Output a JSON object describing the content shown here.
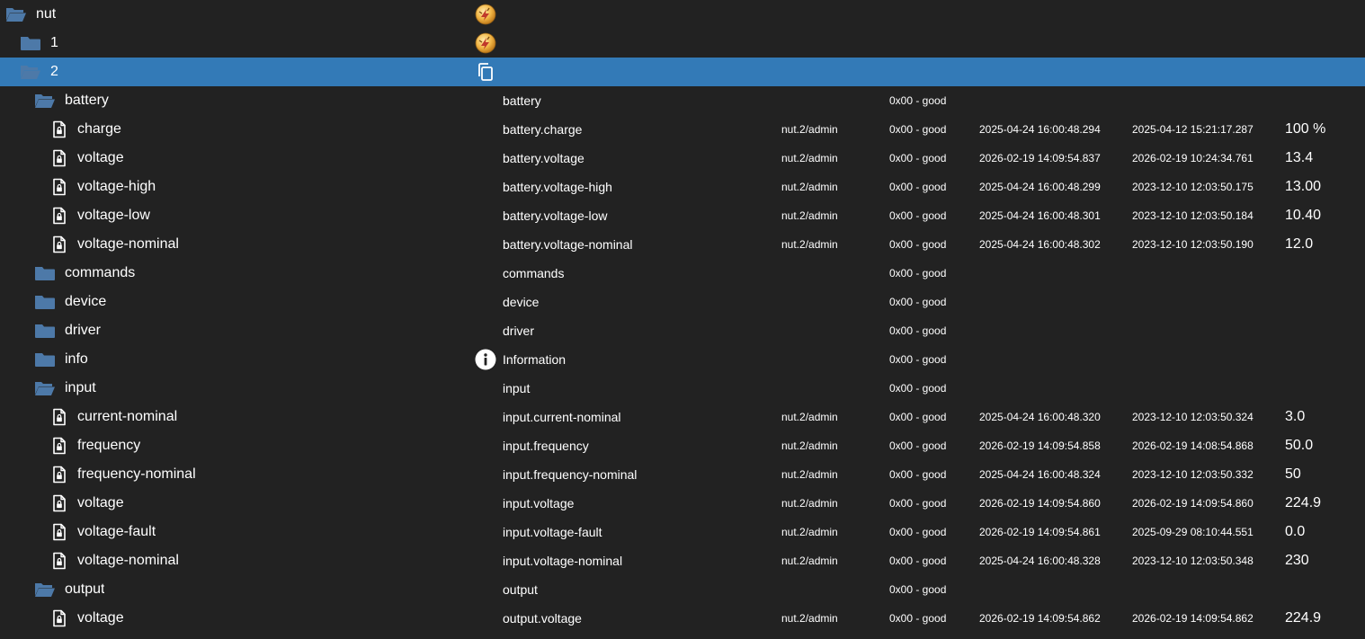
{
  "colors": {
    "background": "#222222",
    "selected_row": "#337ab7",
    "folder": "#4d79a8",
    "text": "#ffffff"
  },
  "rows": [
    {
      "id": "nut",
      "type": "folder-open",
      "name": "nut",
      "desc": "",
      "user": "",
      "quality": "",
      "ts": "",
      "lc": "",
      "value": "",
      "role": "ups"
    },
    {
      "id": "nut-1",
      "type": "folder",
      "name": "1",
      "desc": "",
      "user": "",
      "quality": "",
      "ts": "",
      "lc": "",
      "value": "",
      "role": "ups"
    },
    {
      "id": "nut-2",
      "type": "folder-open",
      "name": "2",
      "desc": "",
      "user": "",
      "quality": "",
      "ts": "",
      "lc": "",
      "value": "",
      "role": "copy",
      "selected": true
    },
    {
      "id": "battery",
      "type": "folder-open",
      "name": "battery",
      "desc": "battery",
      "user": "",
      "quality": "0x00 - good",
      "ts": "",
      "lc": "",
      "value": ""
    },
    {
      "id": "battery-charge",
      "type": "file",
      "name": "charge",
      "desc": "battery.charge",
      "user": "nut.2/admin",
      "quality": "0x00 - good",
      "ts": "2025-04-24 16:00:48.294",
      "lc": "2025-04-12 15:21:17.287",
      "value": "100 %"
    },
    {
      "id": "battery-voltage",
      "type": "file",
      "name": "voltage",
      "desc": "battery.voltage",
      "user": "nut.2/admin",
      "quality": "0x00 - good",
      "ts": "2026-02-19 14:09:54.837",
      "lc": "2026-02-19 10:24:34.761",
      "value": "13.4"
    },
    {
      "id": "battery-voltage-high",
      "type": "file",
      "name": "voltage-high",
      "desc": "battery.voltage-high",
      "user": "nut.2/admin",
      "quality": "0x00 - good",
      "ts": "2025-04-24 16:00:48.299",
      "lc": "2023-12-10 12:03:50.175",
      "value": "13.00"
    },
    {
      "id": "battery-voltage-low",
      "type": "file",
      "name": "voltage-low",
      "desc": "battery.voltage-low",
      "user": "nut.2/admin",
      "quality": "0x00 - good",
      "ts": "2025-04-24 16:00:48.301",
      "lc": "2023-12-10 12:03:50.184",
      "value": "10.40"
    },
    {
      "id": "battery-voltage-nominal",
      "type": "file",
      "name": "voltage-nominal",
      "desc": "battery.voltage-nominal",
      "user": "nut.2/admin",
      "quality": "0x00 - good",
      "ts": "2025-04-24 16:00:48.302",
      "lc": "2023-12-10 12:03:50.190",
      "value": "12.0"
    },
    {
      "id": "commands",
      "type": "folder",
      "name": "commands",
      "desc": "commands",
      "user": "",
      "quality": "0x00 - good",
      "ts": "",
      "lc": "",
      "value": ""
    },
    {
      "id": "device",
      "type": "folder",
      "name": "device",
      "desc": "device",
      "user": "",
      "quality": "0x00 - good",
      "ts": "",
      "lc": "",
      "value": ""
    },
    {
      "id": "driver",
      "type": "folder",
      "name": "driver",
      "desc": "driver",
      "user": "",
      "quality": "0x00 - good",
      "ts": "",
      "lc": "",
      "value": ""
    },
    {
      "id": "info",
      "type": "folder",
      "name": "info",
      "desc": "Information",
      "user": "",
      "quality": "0x00 - good",
      "ts": "",
      "lc": "",
      "value": "",
      "role": "info"
    },
    {
      "id": "input",
      "type": "folder-open",
      "name": "input",
      "desc": "input",
      "user": "",
      "quality": "0x00 - good",
      "ts": "",
      "lc": "",
      "value": ""
    },
    {
      "id": "input-current-nominal",
      "type": "file",
      "name": "current-nominal",
      "desc": "input.current-nominal",
      "user": "nut.2/admin",
      "quality": "0x00 - good",
      "ts": "2025-04-24 16:00:48.320",
      "lc": "2023-12-10 12:03:50.324",
      "value": "3.0"
    },
    {
      "id": "input-frequency",
      "type": "file",
      "name": "frequency",
      "desc": "input.frequency",
      "user": "nut.2/admin",
      "quality": "0x00 - good",
      "ts": "2026-02-19 14:09:54.858",
      "lc": "2026-02-19 14:08:54.868",
      "value": "50.0"
    },
    {
      "id": "input-frequency-nominal",
      "type": "file",
      "name": "frequency-nominal",
      "desc": "input.frequency-nominal",
      "user": "nut.2/admin",
      "quality": "0x00 - good",
      "ts": "2025-04-24 16:00:48.324",
      "lc": "2023-12-10 12:03:50.332",
      "value": "50"
    },
    {
      "id": "input-voltage",
      "type": "file",
      "name": "voltage",
      "desc": "input.voltage",
      "user": "nut.2/admin",
      "quality": "0x00 - good",
      "ts": "2026-02-19 14:09:54.860",
      "lc": "2026-02-19 14:09:54.860",
      "value": "224.9"
    },
    {
      "id": "input-voltage-fault",
      "type": "file",
      "name": "voltage-fault",
      "desc": "input.voltage-fault",
      "user": "nut.2/admin",
      "quality": "0x00 - good",
      "ts": "2026-02-19 14:09:54.861",
      "lc": "2025-09-29 08:10:44.551",
      "value": "0.0"
    },
    {
      "id": "input-voltage-nominal",
      "type": "file",
      "name": "voltage-nominal",
      "desc": "input.voltage-nominal",
      "user": "nut.2/admin",
      "quality": "0x00 - good",
      "ts": "2025-04-24 16:00:48.328",
      "lc": "2023-12-10 12:03:50.348",
      "value": "230"
    },
    {
      "id": "output",
      "type": "folder-open",
      "name": "output",
      "desc": "output",
      "user": "",
      "quality": "0x00 - good",
      "ts": "",
      "lc": "",
      "value": ""
    },
    {
      "id": "output-voltage",
      "type": "file",
      "name": "voltage",
      "desc": "output.voltage",
      "user": "nut.2/admin",
      "quality": "0x00 - good",
      "ts": "2026-02-19 14:09:54.862",
      "lc": "2026-02-19 14:09:54.862",
      "value": "224.9"
    }
  ]
}
